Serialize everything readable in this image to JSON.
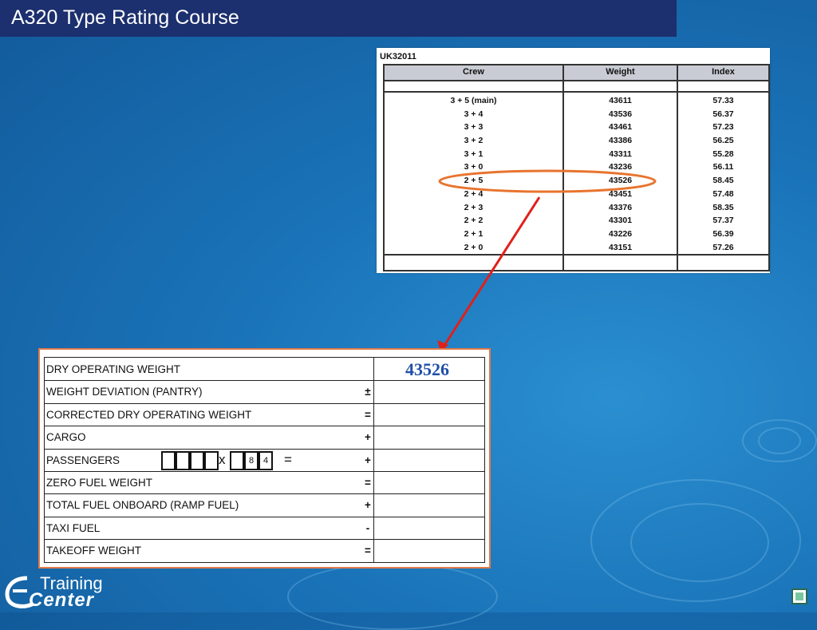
{
  "title": "A320 Type Rating Course",
  "crew_table": {
    "code": "UK32011",
    "headers": [
      "Crew",
      "Weight",
      "Index"
    ],
    "rows": [
      [
        "3 + 5 (main)",
        "43611",
        "57.33"
      ],
      [
        "3 + 4",
        "43536",
        "56.37"
      ],
      [
        "3 + 3",
        "43461",
        "57.23"
      ],
      [
        "3 + 2",
        "43386",
        "56.25"
      ],
      [
        "3 + 1",
        "43311",
        "55.28"
      ],
      [
        "3 + 0",
        "43236",
        "56.11"
      ],
      [
        "2 + 5",
        "43526",
        "58.45"
      ],
      [
        "2 + 4",
        "43451",
        "57.48"
      ],
      [
        "2 + 3",
        "43376",
        "58.35"
      ],
      [
        "2 + 2",
        "43301",
        "57.37"
      ],
      [
        "2 + 1",
        "43226",
        "56.39"
      ],
      [
        "2 + 0",
        "43151",
        "57.26"
      ]
    ],
    "highlighted_row": 6
  },
  "form": {
    "rows": [
      {
        "label": "DRY OPERATING WEIGHT",
        "sign": ""
      },
      {
        "label": "WEIGHT DEVIATION (PANTRY)",
        "sign": "±"
      },
      {
        "label": "CORRECTED DRY OPERATING WEIGHT",
        "sign": "="
      },
      {
        "label": "CARGO",
        "sign": "+"
      },
      {
        "label": "PASSENGERS",
        "sign": "+"
      },
      {
        "label": "ZERO FUEL WEIGHT",
        "sign": "="
      },
      {
        "label": "TOTAL FUEL ONBOARD  (RAMP FUEL)",
        "sign": "+"
      },
      {
        "label": "TAXI FUEL",
        "sign": "-"
      },
      {
        "label": "TAKEOFF WEIGHT",
        "sign": "="
      }
    ],
    "passenger_multiplier": "x",
    "passenger_equals": "=",
    "passenger_weight_digits": [
      "8",
      "4"
    ],
    "dry_operating_weight_value": "43526"
  },
  "logo": {
    "line1": "Training",
    "line2": "Center"
  },
  "colors": {
    "title_bar": "#1c2f6e",
    "highlight": "#e8742e",
    "answer": "#1f4fa8",
    "arrow": "#e0201c"
  },
  "icons": {
    "nav": "square-icon"
  }
}
